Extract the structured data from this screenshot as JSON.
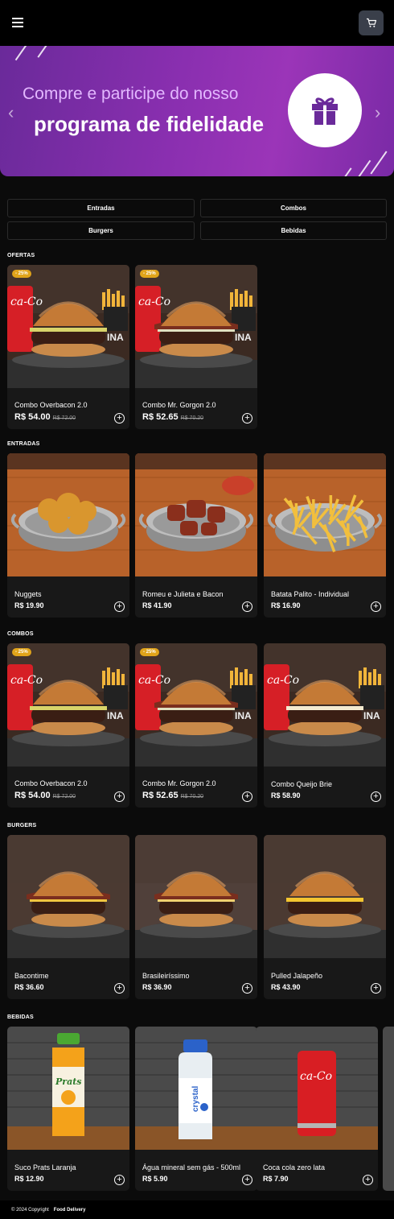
{
  "header": {
    "menu_icon": "hamburger-menu-icon",
    "cart_icon": "shopping-cart-icon"
  },
  "banner": {
    "line1": "Compre e participe do nosso",
    "line2": "programa de fidelidade",
    "icon": "gift-icon",
    "prev_icon": "chevron-left-icon",
    "next_icon": "chevron-right-icon",
    "colors": {
      "start": "#6a2a9a",
      "end": "#9b35b8",
      "accent": "#e3b8ff"
    }
  },
  "categories": [
    "Entradas",
    "Combos",
    "Burgers",
    "Bebidas"
  ],
  "sections": [
    {
      "title": "OFERTAS",
      "items": [
        {
          "name": "Combo Overbacon 2.0",
          "price": "R$ 54.00",
          "old_price": "R$ 72.00",
          "badge": "- 25%",
          "image": "combo-overbacon"
        },
        {
          "name": "Combo Mr. Gorgon 2.0",
          "price": "R$ 52.65",
          "old_price": "R$ 70.20",
          "badge": "- 25%",
          "image": "combo-gorgon"
        }
      ]
    },
    {
      "title": "ENTRADAS",
      "items": [
        {
          "name": "Nuggets",
          "price": "R$ 19.90",
          "image": "nuggets"
        },
        {
          "name": "Romeu e Julieta e Bacon",
          "price": "R$ 41.90",
          "image": "romeu-julieta"
        },
        {
          "name": "Batata Palito - Individual",
          "price": "R$ 16.90",
          "image": "fries"
        }
      ]
    },
    {
      "title": "COMBOS",
      "items": [
        {
          "name": "Combo Overbacon 2.0",
          "price": "R$ 54.00",
          "old_price": "R$ 72.00",
          "badge": "- 25%",
          "image": "combo-overbacon"
        },
        {
          "name": "Combo Mr. Gorgon 2.0",
          "price": "R$ 52.65",
          "old_price": "R$ 70.20",
          "badge": "- 25%",
          "image": "combo-gorgon"
        },
        {
          "name": "Combo Queijo Brie",
          "price": "R$ 58.90",
          "image": "combo-brie"
        }
      ]
    },
    {
      "title": "BURGERS",
      "items": [
        {
          "name": "Bacontime",
          "price": "R$ 36.60",
          "image": "burger-bacontime"
        },
        {
          "name": "Brasileiríssimo",
          "price": "R$ 36.90",
          "image": "burger-brasileirissimo"
        },
        {
          "name": "Pulled Jalapeño",
          "price": "R$ 43.90",
          "image": "burger-jalapeno"
        }
      ]
    },
    {
      "title": "BEBIDAS",
      "items": [
        {
          "name": "Suco Prats Laranja",
          "price": "R$ 12.90",
          "image": "juice"
        },
        {
          "name": "Água mineral sem gás - 500ml",
          "price": "R$ 5.90",
          "image": "water"
        },
        {
          "name": "Coca cola zero lata",
          "price": "R$ 7.90",
          "image": "coke"
        }
      ]
    }
  ],
  "footer": {
    "copyright": "© 2024 Copyright",
    "brand": "Food Delivery"
  }
}
